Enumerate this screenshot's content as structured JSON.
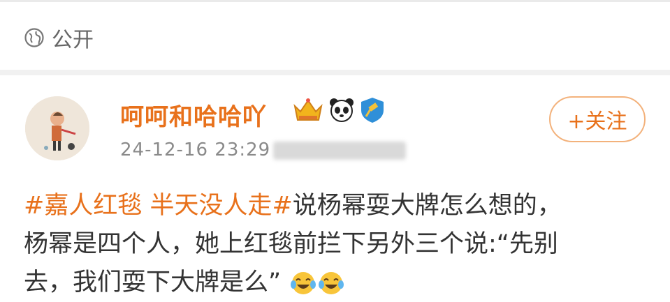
{
  "visibility": {
    "label": "公开"
  },
  "post": {
    "username": "呵呵和哈哈吖",
    "timestamp": "24-12-16 23:29",
    "follow_label": "+关注",
    "hashtag": "#嘉人红毯 半天没人走#",
    "text_1": "说杨幂耍大牌怎么想的，",
    "text_2": "杨幂是四个人，她上红毯前拦下另外三个说:“先别",
    "text_3": "去，我们耍下大牌是么”"
  },
  "colors": {
    "accent": "#e8711b",
    "muted": "#8a8a8a",
    "text": "#333333"
  },
  "icons": [
    "globe-icon",
    "crown-badge-icon",
    "panda-badge-icon",
    "gavel-badge-icon",
    "laughing-tears-emoji"
  ]
}
